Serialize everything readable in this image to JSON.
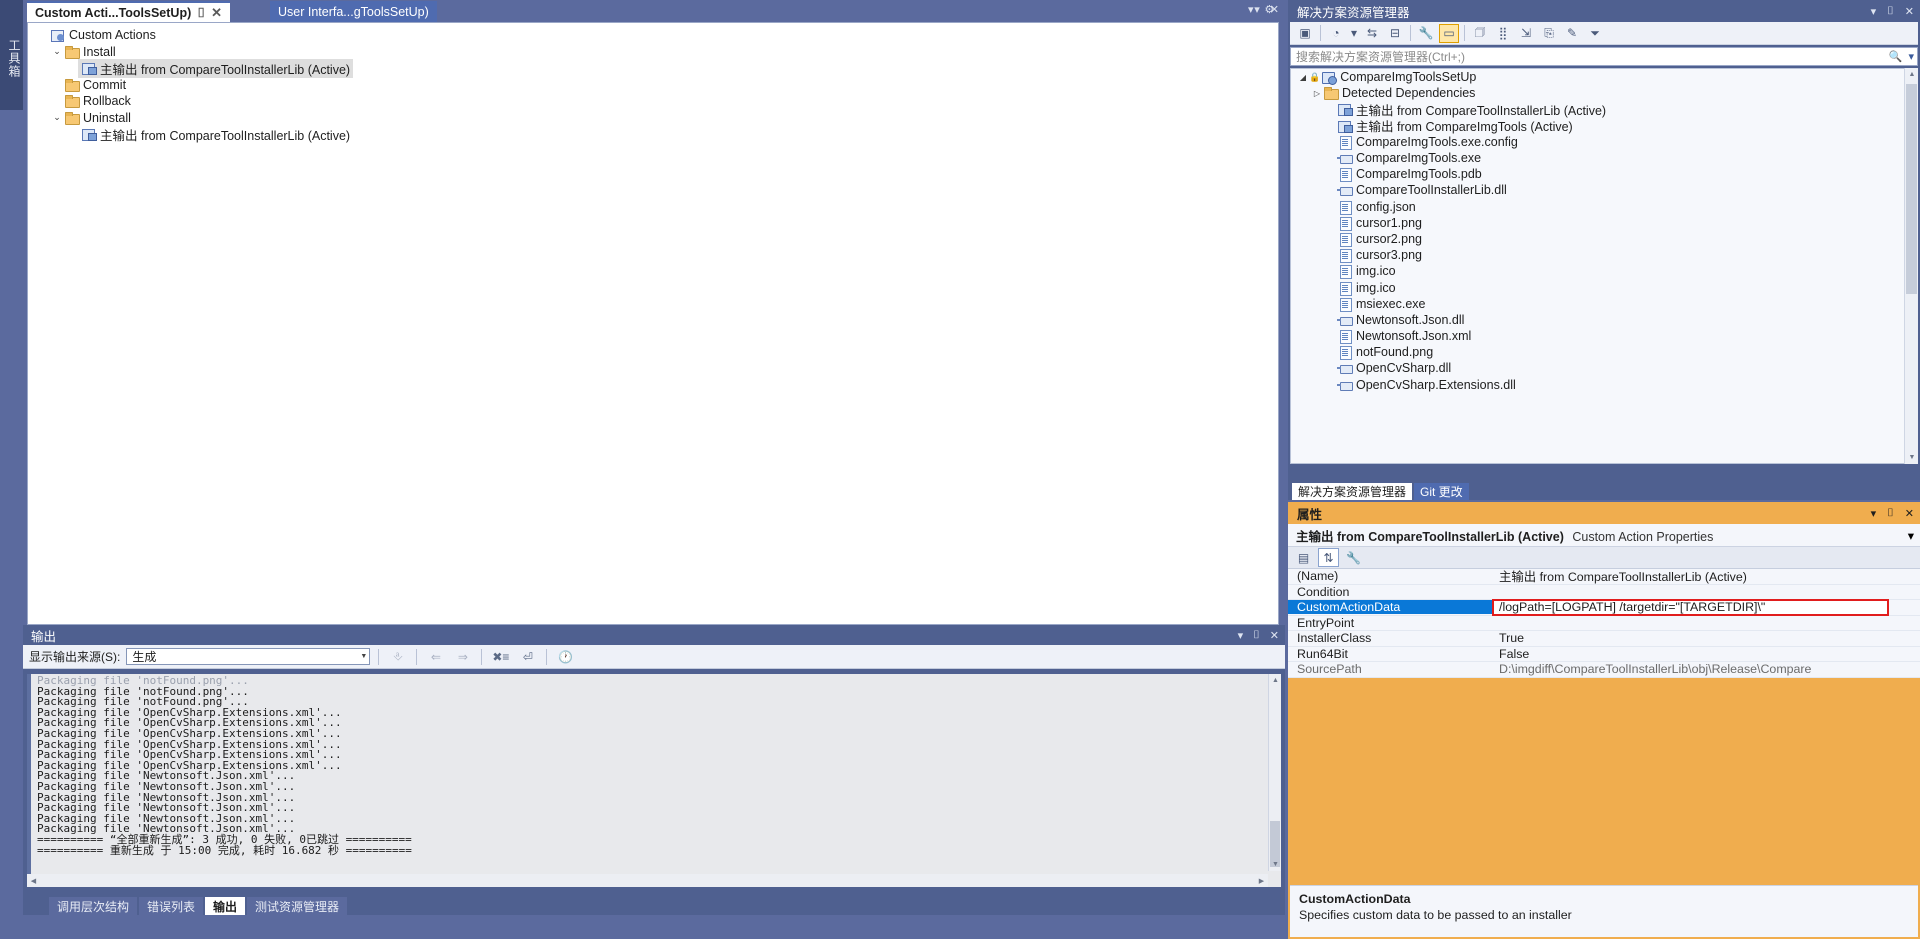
{
  "toolbox": {
    "label": "工具箱"
  },
  "editor": {
    "tabs": [
      {
        "title": "Custom Acti...ToolsSetUp)",
        "active": true,
        "pin": "⌷",
        "close": "✕"
      },
      {
        "title": "User Interfa...gToolsSetUp)",
        "active": false
      }
    ],
    "tabstrip_controls": [
      "▾",
      "✕"
    ],
    "tree": [
      {
        "indent": 0,
        "expander": "",
        "icon": "custom-actions-icon",
        "label": "Custom Actions",
        "selected": false
      },
      {
        "indent": 1,
        "expander": "⌄",
        "icon": "folder-icon",
        "label": "Install",
        "selected": false
      },
      {
        "indent": 2,
        "expander": "",
        "icon": "primary-output-icon",
        "label": "主输出 from CompareToolInstallerLib (Active)",
        "selected": true
      },
      {
        "indent": 2,
        "expander": "",
        "icon": "folder-icon",
        "label": "Commit",
        "selected": false
      },
      {
        "indent": 2,
        "expander": "",
        "icon": "folder-icon",
        "label": "Rollback",
        "selected": false
      },
      {
        "indent": 1,
        "expander": "⌄",
        "icon": "folder-icon",
        "label": "Uninstall",
        "selected": false
      },
      {
        "indent": 2,
        "expander": "",
        "icon": "primary-output-icon",
        "label": "主输出 from CompareToolInstallerLib (Active)",
        "selected": false
      }
    ]
  },
  "output": {
    "title": "输出",
    "controls": [
      "▾",
      "⌷",
      "✕"
    ],
    "source_label": "显示输出来源(S):",
    "source_value": "生成",
    "toolbar_icons": [
      "clear-all-icon",
      "go-to-previous-icon",
      "go-to-next-icon",
      "clear-pane-icon",
      "toggle-word-wrap-icon",
      "show-timestamps-icon"
    ],
    "lines": [
      "Packaging file 'notFound.png'...",
      "Packaging file 'notFound.png'...",
      "Packaging file 'notFound.png'...",
      "Packaging file 'OpenCvSharp.Extensions.xml'...",
      "Packaging file 'OpenCvSharp.Extensions.xml'...",
      "Packaging file 'OpenCvSharp.Extensions.xml'...",
      "Packaging file 'OpenCvSharp.Extensions.xml'...",
      "Packaging file 'OpenCvSharp.Extensions.xml'...",
      "Packaging file 'OpenCvSharp.Extensions.xml'...",
      "Packaging file 'Newtonsoft.Json.xml'...",
      "Packaging file 'Newtonsoft.Json.xml'...",
      "Packaging file 'Newtonsoft.Json.xml'...",
      "Packaging file 'Newtonsoft.Json.xml'...",
      "Packaging file 'Newtonsoft.Json.xml'...",
      "Packaging file 'Newtonsoft.Json.xml'...",
      "========== “全部重新生成”: 3 成功, 0 失败, 0已跳过 ==========",
      "========== 重新生成 于 15:00 完成, 耗时 16.682 秒 =========="
    ]
  },
  "bottom_tabs": [
    {
      "label": "调用层次结构",
      "active": false
    },
    {
      "label": "错误列表",
      "active": false
    },
    {
      "label": "输出",
      "active": true
    },
    {
      "label": "测试资源管理器",
      "active": false
    }
  ],
  "solution_explorer": {
    "title": "解决方案资源管理器",
    "controls": [
      "▾",
      "⌷",
      "✕"
    ],
    "toolbar_icons": [
      "code-view-icon",
      "pending-changes-filter-icon",
      "chevron-down-icon",
      "sync-with-active-document-icon",
      "collapse-all-icon",
      "properties-wrench-icon",
      "show-preview-selection-icon",
      "new-folder-icon",
      "show-all-files-icon",
      "refresh-icon",
      "add-new-item-icon",
      "view-designer-icon",
      "filter-icon"
    ],
    "search_placeholder": "搜索解决方案资源管理器(Ctrl+;)",
    "search_value": "",
    "tree": [
      {
        "indent": 0,
        "expander": "◢",
        "lock": true,
        "icon": "project-icon",
        "label": "CompareImgToolsSetUp"
      },
      {
        "indent": 1,
        "expander": "▷",
        "lock": false,
        "icon": "folder-icon",
        "label": "Detected Dependencies"
      },
      {
        "indent": 2,
        "expander": "",
        "lock": false,
        "icon": "primary-output-icon",
        "label": "主输出 from CompareToolInstallerLib (Active)"
      },
      {
        "indent": 2,
        "expander": "",
        "lock": false,
        "icon": "primary-output-icon",
        "label": "主输出 from CompareImgTools (Active)"
      },
      {
        "indent": 2,
        "expander": "",
        "lock": false,
        "icon": "document-icon",
        "label": "CompareImgTools.exe.config"
      },
      {
        "indent": 2,
        "expander": "",
        "lock": false,
        "icon": "assembly-icon",
        "label": "CompareImgTools.exe"
      },
      {
        "indent": 2,
        "expander": "",
        "lock": false,
        "icon": "document-icon",
        "label": "CompareImgTools.pdb"
      },
      {
        "indent": 2,
        "expander": "",
        "lock": false,
        "icon": "assembly-icon",
        "label": "CompareToolInstallerLib.dll"
      },
      {
        "indent": 2,
        "expander": "",
        "lock": false,
        "icon": "document-icon",
        "label": "config.json"
      },
      {
        "indent": 2,
        "expander": "",
        "lock": false,
        "icon": "document-icon",
        "label": "cursor1.png"
      },
      {
        "indent": 2,
        "expander": "",
        "lock": false,
        "icon": "document-icon",
        "label": "cursor2.png"
      },
      {
        "indent": 2,
        "expander": "",
        "lock": false,
        "icon": "document-icon",
        "label": "cursor3.png"
      },
      {
        "indent": 2,
        "expander": "",
        "lock": false,
        "icon": "document-icon",
        "label": "img.ico"
      },
      {
        "indent": 2,
        "expander": "",
        "lock": false,
        "icon": "document-icon",
        "label": "img.ico"
      },
      {
        "indent": 2,
        "expander": "",
        "lock": false,
        "icon": "document-icon",
        "label": "msiexec.exe"
      },
      {
        "indent": 2,
        "expander": "",
        "lock": false,
        "icon": "assembly-icon",
        "label": "Newtonsoft.Json.dll"
      },
      {
        "indent": 2,
        "expander": "",
        "lock": false,
        "icon": "document-icon",
        "label": "Newtonsoft.Json.xml"
      },
      {
        "indent": 2,
        "expander": "",
        "lock": false,
        "icon": "document-icon",
        "label": "notFound.png"
      },
      {
        "indent": 2,
        "expander": "",
        "lock": false,
        "icon": "assembly-icon",
        "label": "OpenCvSharp.dll"
      },
      {
        "indent": 2,
        "expander": "",
        "lock": false,
        "icon": "assembly-icon",
        "label": "OpenCvSharp.Extensions.dll"
      }
    ],
    "tabs": [
      {
        "label": "解决方案资源管理器",
        "active": true
      },
      {
        "label": "Git 更改",
        "active": false
      }
    ]
  },
  "properties": {
    "title": "属性",
    "controls": [
      "▾",
      "⌷",
      "✕"
    ],
    "object_name": "主输出 from CompareToolInstallerLib (Active)",
    "object_type": "Custom Action Properties",
    "object_dropdown": "▾",
    "toolbar_icons": [
      "categorized-icon",
      "alphabetical-sort-icon",
      "property-pages-icon"
    ],
    "rows": [
      {
        "name": "(Name)",
        "value": "主输出 from CompareToolInstallerLib (Active)",
        "selected": false,
        "dim": false,
        "highlighted": false
      },
      {
        "name": "Condition",
        "value": "",
        "selected": false,
        "dim": false,
        "highlighted": false
      },
      {
        "name": "CustomActionData",
        "value": "/logPath=[LOGPATH] /targetdir=\"[TARGETDIR]\\\"",
        "selected": true,
        "dim": false,
        "highlighted": true
      },
      {
        "name": "EntryPoint",
        "value": "",
        "selected": false,
        "dim": false,
        "highlighted": false
      },
      {
        "name": "InstallerClass",
        "value": "True",
        "selected": false,
        "dim": false,
        "highlighted": false
      },
      {
        "name": "Run64Bit",
        "value": "False",
        "selected": false,
        "dim": false,
        "highlighted": false
      },
      {
        "name": "SourcePath",
        "value": "D:\\imgdiff\\CompareToolInstallerLib\\obj\\Release\\Compare",
        "selected": false,
        "dim": true,
        "highlighted": false
      }
    ],
    "description_title": "CustomActionData",
    "description_text": "Specifies custom data to be passed to an installer"
  },
  "colors": {
    "chrome_blue": "#5b6a9e",
    "panel_header_blue": "#4f6090",
    "properties_header_orange": "#f0ad4e",
    "selection_blue": "#0a78d7",
    "highlight_red": "#e11d1d",
    "active_tab_white": "#ffffff"
  }
}
